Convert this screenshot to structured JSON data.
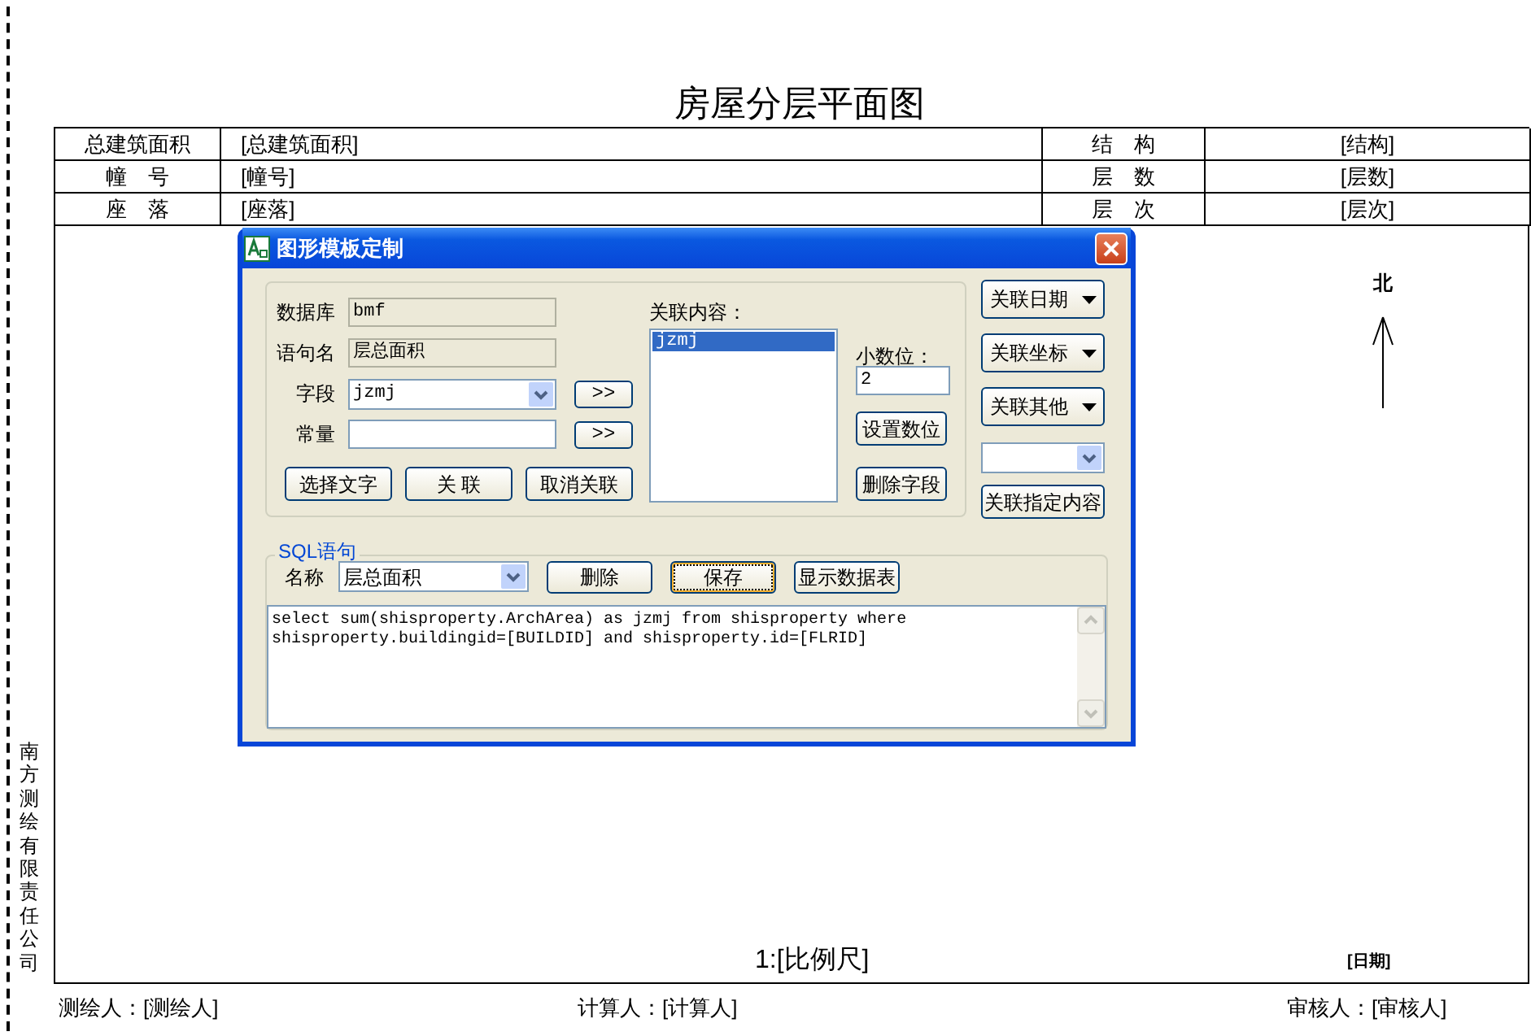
{
  "title": "房屋分层平面图",
  "info_table": {
    "rows": [
      [
        "总建筑面积",
        "[总建筑面积]",
        "结　构",
        "[结构]"
      ],
      [
        "幢　号",
        "[幢号]",
        "层　数",
        "[层数]"
      ],
      [
        "座　落",
        "[座落]",
        "层　次",
        "[层次]"
      ]
    ]
  },
  "compass": {
    "label": "北"
  },
  "company": "南方测绘有限责任公司",
  "scale": "1:[比例尺]",
  "date": "[日期]",
  "signatures": [
    "测绘人：[测绘人]",
    "计算人：[计算人]",
    "审核人：[审核人]"
  ],
  "dialog": {
    "title": "图形模板定制",
    "fields": [
      {
        "label": "数据库",
        "kind": "text",
        "value": "bmf",
        "disabled": true
      },
      {
        "label": "语句名",
        "kind": "text",
        "value": "层总面积",
        "disabled": true
      },
      {
        "label": "字段",
        "kind": "combo",
        "value": "jzmj",
        "button": ">>"
      },
      {
        "label": "常量",
        "kind": "text",
        "disabled": false,
        "button": ">>"
      }
    ],
    "action_buttons": [
      "选择文字",
      "关 联",
      "取消关联"
    ],
    "linked_content": {
      "label": "关联内容：",
      "items": [
        {
          "text": "jzmj",
          "selected": true
        }
      ]
    },
    "decimals": {
      "label": "小数位：",
      "value": "2"
    },
    "decimal_buttons": [
      "设置数位",
      "删除字段"
    ],
    "side_controls": [
      {
        "kind": "menu",
        "label": "关联日期"
      },
      {
        "kind": "menu",
        "label": "关联坐标"
      },
      {
        "kind": "menu",
        "label": "关联其他"
      },
      {
        "kind": "combo"
      },
      {
        "kind": "button",
        "label": "关联指定内容"
      }
    ],
    "sql": {
      "legend": "SQL语句",
      "name_label": "名称",
      "name_value": "层总面积",
      "buttons": [
        {
          "label": "删除",
          "focused": false
        },
        {
          "label": "保存",
          "focused": true
        },
        {
          "label": "显示数据表",
          "focused": false
        }
      ],
      "text": "select sum(shisproperty.ArchArea) as jzmj from shisproperty where shisproperty.buildingid=[BUILDID] and shisproperty.id=[FLRID]"
    }
  }
}
